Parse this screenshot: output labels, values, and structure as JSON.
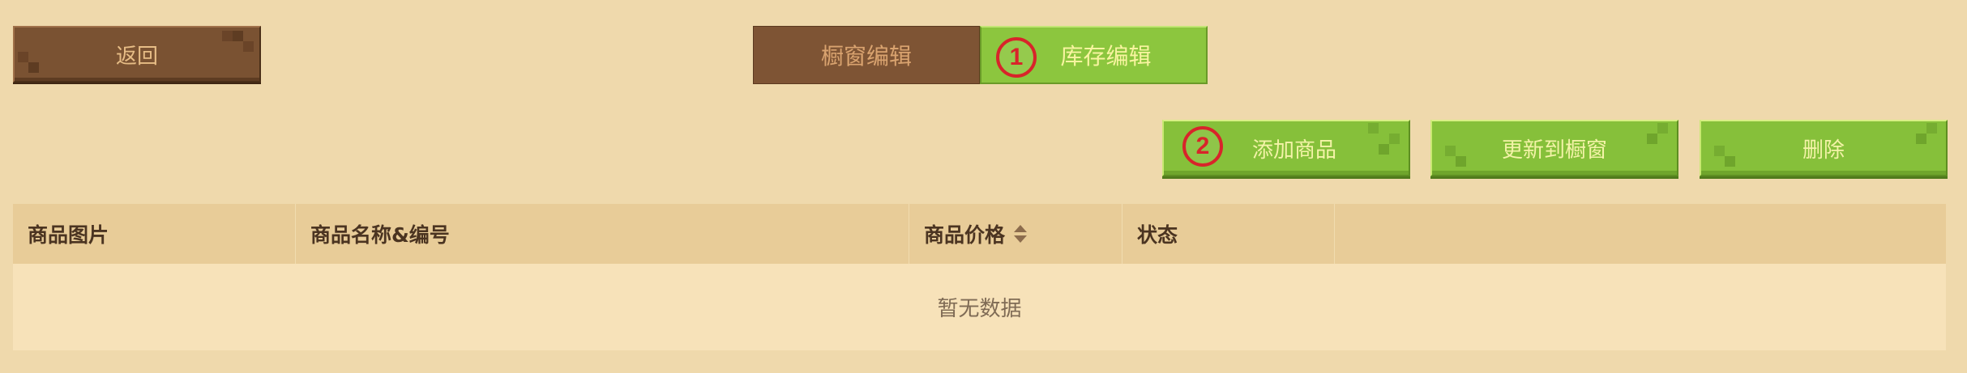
{
  "back_button": {
    "label": "返回"
  },
  "tabs": [
    {
      "label": "橱窗编辑",
      "active": false
    },
    {
      "label": "库存编辑",
      "active": true
    }
  ],
  "markers": [
    "1",
    "2"
  ],
  "actions": {
    "add_label": "添加商品",
    "update_label": "更新到橱窗",
    "delete_label": "删除"
  },
  "table": {
    "columns": [
      "商品图片",
      "商品名称&编号",
      "商品价格",
      "状态",
      ""
    ],
    "empty_text": "暂无数据"
  },
  "colors": {
    "background": "#efd9ac",
    "brown_button": "#7a5232",
    "green_button": "#86c03a",
    "marker_red": "#d8242a",
    "table_header": "#e8cc98",
    "table_body": "#f7e2b9"
  },
  "icons": {
    "sort": "sort-icon"
  }
}
